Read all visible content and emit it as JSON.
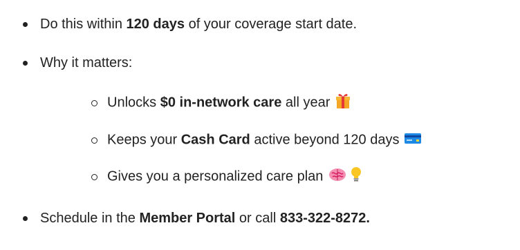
{
  "bullets": [
    {
      "parts": [
        "Do this within ",
        "120 days",
        " of your coverage start date."
      ]
    },
    {
      "parts": [
        "Why it matters:"
      ]
    },
    {
      "parts": [
        "Schedule in the ",
        "Member Portal",
        " or call ",
        "833-322-8272."
      ]
    }
  ],
  "sub_bullets": [
    {
      "parts": [
        "Unlocks ",
        "$0 in-network care",
        " all year"
      ],
      "icons": [
        "gift-icon"
      ]
    },
    {
      "parts": [
        "Keeps your ",
        "Cash Card",
        " active beyond 120 days"
      ],
      "icons": [
        "credit-card-icon"
      ]
    },
    {
      "parts": [
        "Gives you a personalized care plan"
      ],
      "icons": [
        "brain-icon",
        "lightbulb-icon"
      ]
    }
  ],
  "colors": {
    "text": "#222222",
    "gift": "#f5a623",
    "card": "#1e88e5",
    "brain": "#f06292",
    "bulb": "#f9c623"
  }
}
